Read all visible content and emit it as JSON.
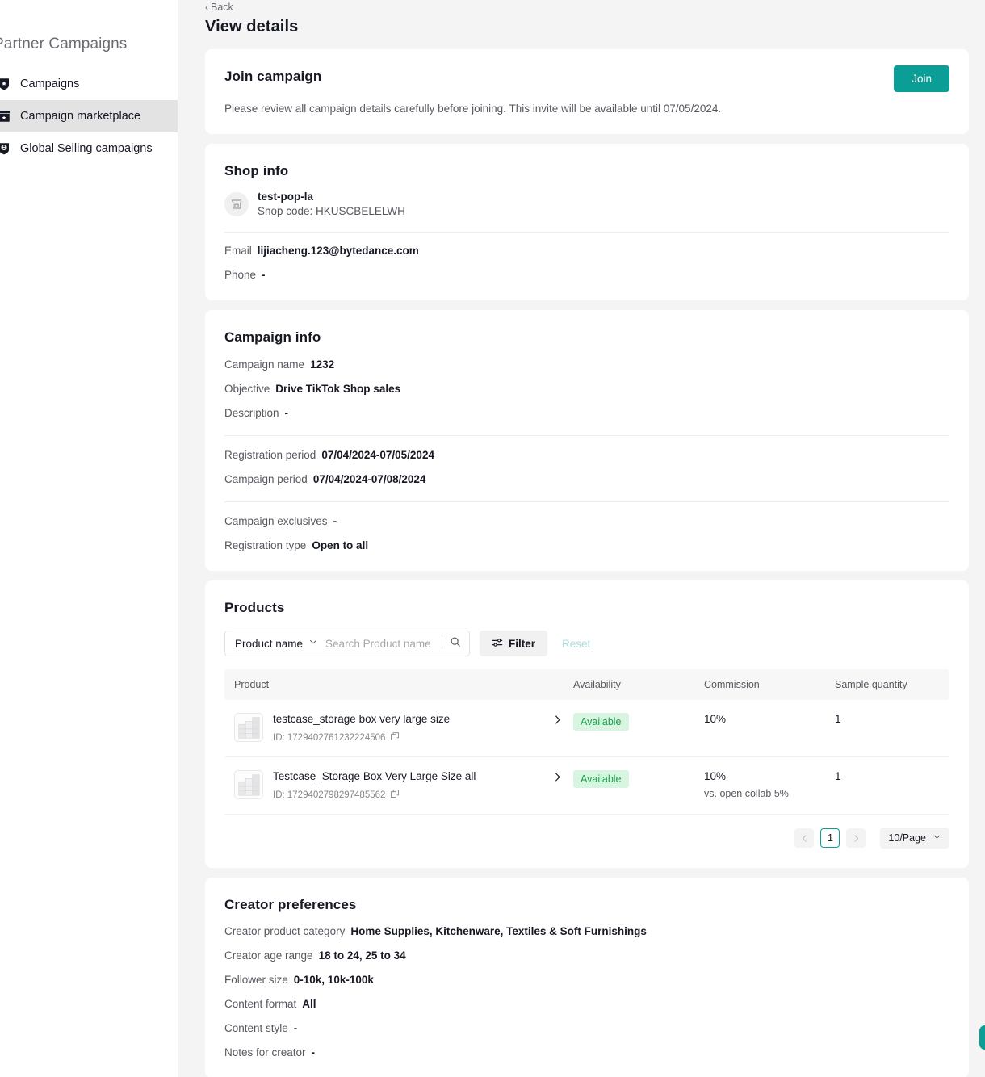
{
  "sidebar": {
    "title": "Partner Campaigns",
    "items": [
      {
        "label": "Campaigns",
        "icon": "shield-star-icon",
        "active": false
      },
      {
        "label": "Campaign marketplace",
        "icon": "storefront-icon",
        "active": true
      },
      {
        "label": "Global Selling campaigns",
        "icon": "shield-globe-icon",
        "active": false
      }
    ]
  },
  "header": {
    "back_label": "Back",
    "page_title": "View details"
  },
  "join": {
    "title": "Join campaign",
    "description": "Please review all campaign details carefully before joining. This invite will be available until 07/05/2024.",
    "button_label": "Join",
    "button_color": "#0b9e96"
  },
  "shop_info": {
    "title": "Shop info",
    "shop_name": "test-pop-la",
    "shop_code": "Shop code: HKUSCBELELWH",
    "fields": [
      {
        "label": "Email",
        "value": "lijiacheng.123@bytedance.com"
      },
      {
        "label": "Phone",
        "value": "-"
      }
    ]
  },
  "campaign_info": {
    "title": "Campaign info",
    "group1": [
      {
        "label": "Campaign name",
        "value": "1232"
      },
      {
        "label": "Objective",
        "value": "Drive TikTok Shop sales"
      },
      {
        "label": "Description",
        "value": "-"
      }
    ],
    "group2": [
      {
        "label": "Registration period",
        "value": "07/04/2024-07/05/2024"
      },
      {
        "label": "Campaign period",
        "value": "07/04/2024-07/08/2024"
      }
    ],
    "group3": [
      {
        "label": "Campaign exclusives",
        "value": "-"
      },
      {
        "label": "Registration type",
        "value": "Open to all"
      }
    ]
  },
  "products": {
    "title": "Products",
    "search": {
      "select_value": "Product name",
      "placeholder": "Search Product name",
      "value": ""
    },
    "filter_label": "Filter",
    "reset_label": "Reset",
    "columns": [
      "Product",
      "Availability",
      "Commission",
      "Sample quantity"
    ],
    "rows": [
      {
        "name": "testcase_storage box very large size",
        "id": "ID: 1729402761232224506",
        "availability": "Available",
        "commission": "10%",
        "commission_sub": "",
        "sample_quantity": "1"
      },
      {
        "name": "Testcase_Storage Box Very Large Size all",
        "id": "ID: 1729402798297485562",
        "availability": "Available",
        "commission": "10%",
        "commission_sub": "vs. open collab 5%",
        "sample_quantity": "1"
      }
    ],
    "pagination": {
      "current_page": "1",
      "page_size": "10/Page"
    }
  },
  "creator_preferences": {
    "title": "Creator preferences",
    "fields": [
      {
        "label": "Creator product category",
        "value": "Home Supplies, Kitchenware, Textiles & Soft Furnishings"
      },
      {
        "label": "Creator age range",
        "value": "18 to 24, 25 to 34"
      },
      {
        "label": "Follower size",
        "value": "0-10k, 10k-100k"
      },
      {
        "label": "Content format",
        "value": "All"
      },
      {
        "label": "Content style",
        "value": "-"
      },
      {
        "label": "Notes for creator",
        "value": "-"
      }
    ]
  }
}
